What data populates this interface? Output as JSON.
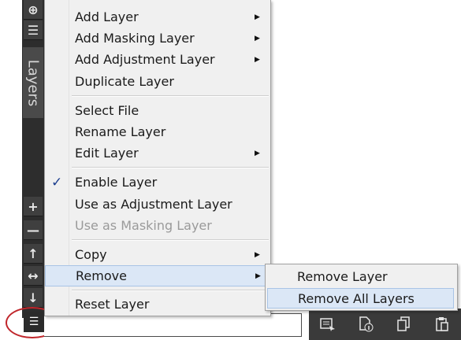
{
  "panel": {
    "tab_label": "Layers",
    "tools": {
      "zoom": "⊕",
      "properties": "☰",
      "add": "+",
      "remove": "—",
      "move_up": "↑",
      "move_both": "↔",
      "move_down": "↓",
      "bottom_menu": "☰"
    }
  },
  "context_menu": {
    "items": [
      {
        "label": "Add Layer",
        "submenu": true
      },
      {
        "label": "Add Masking Layer",
        "submenu": true
      },
      {
        "label": "Add Adjustment Layer",
        "submenu": true
      },
      {
        "label": "Duplicate Layer"
      },
      {
        "label": "Select File"
      },
      {
        "label": "Rename Layer"
      },
      {
        "label": "Edit Layer",
        "submenu": true
      },
      {
        "label": "Enable Layer",
        "checked": true,
        "check_mark": "✓"
      },
      {
        "label": "Use as Adjustment Layer"
      },
      {
        "label": "Use as Masking Layer",
        "disabled": true
      },
      {
        "label": "Copy",
        "submenu": true
      },
      {
        "label": "Remove",
        "submenu": true,
        "highlighted": true
      },
      {
        "label": "Reset Layer"
      }
    ],
    "arrow_glyph": "▶"
  },
  "remove_submenu": {
    "items": [
      {
        "label": "Remove Layer"
      },
      {
        "label": "Remove All Layers",
        "highlighted": true
      }
    ]
  },
  "bottom_panel": {
    "icons": [
      "properties-icon",
      "info-icon",
      "copy-icon",
      "paste-icon"
    ]
  },
  "colors": {
    "highlight": "#dbe7f6",
    "annotation_circle": "#c0262b",
    "toolbar_dark": "#2d2d2d"
  }
}
